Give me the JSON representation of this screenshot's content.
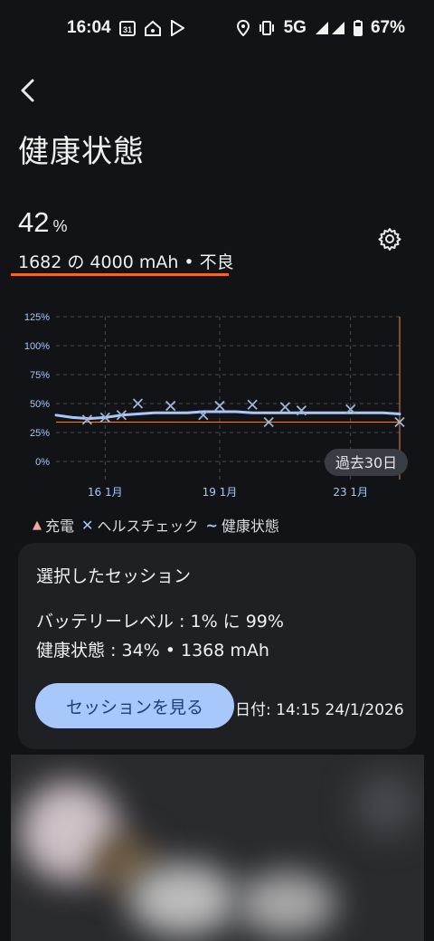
{
  "status_bar": {
    "time": "16:04",
    "calendar_badge": "31",
    "network": "5G",
    "battery": "67%"
  },
  "page": {
    "title": "健康状態",
    "health_percent": "42",
    "percent_unit": "%",
    "capacity_text": "1682 の 4000 mAh • 不良"
  },
  "colors": {
    "accent_underline": "#ef6a1a",
    "series_health": "#a8c7fa",
    "threshold_line": "#e08a3c",
    "button_bg": "#a8c7fa"
  },
  "chart_data": {
    "type": "line",
    "y_ticks": [
      "125%",
      "100%",
      "75%",
      "50%",
      "25%",
      "0%"
    ],
    "x_ticks": [
      "16 1月",
      "19 1月",
      "23 1月"
    ],
    "ylim": [
      0,
      125
    ],
    "range_label": "過去30日",
    "threshold": 34,
    "series": [
      {
        "name": "健康状態",
        "points": [
          [
            0,
            40
          ],
          [
            1,
            38
          ],
          [
            2,
            37
          ],
          [
            3,
            38
          ],
          [
            4,
            40
          ],
          [
            5,
            41
          ],
          [
            6,
            42
          ],
          [
            7,
            42
          ],
          [
            8,
            42
          ],
          [
            9,
            43
          ],
          [
            10,
            43
          ],
          [
            11,
            43
          ],
          [
            12,
            42
          ],
          [
            13,
            42
          ],
          [
            14,
            42
          ],
          [
            15,
            42
          ],
          [
            16,
            42
          ],
          [
            17,
            42
          ],
          [
            18,
            42
          ],
          [
            19,
            42
          ],
          [
            20,
            42
          ],
          [
            21,
            41
          ]
        ]
      },
      {
        "name": "ヘルスチェック",
        "points": [
          [
            1.9,
            36
          ],
          [
            3,
            38
          ],
          [
            4,
            40
          ],
          [
            5,
            50
          ],
          [
            7,
            48
          ],
          [
            9,
            40
          ],
          [
            10,
            48
          ],
          [
            12,
            49
          ],
          [
            13,
            34
          ],
          [
            14,
            47
          ],
          [
            15,
            44
          ],
          [
            18,
            45
          ],
          [
            21,
            34
          ]
        ]
      }
    ],
    "legend": [
      {
        "symbol": "▲",
        "label": "充電"
      },
      {
        "symbol": "✕",
        "label": "ヘルスチェック"
      },
      {
        "symbol": "~",
        "label": "健康状態"
      }
    ]
  },
  "session_card": {
    "title": "選択したセッション",
    "battery_level": "バッテリーレベル : 1% に 99%",
    "health": "健康状態 : 34% • 1368 mAh",
    "button_label": "セッションを見る",
    "date": "日付: 14:15  24/1/2026"
  }
}
